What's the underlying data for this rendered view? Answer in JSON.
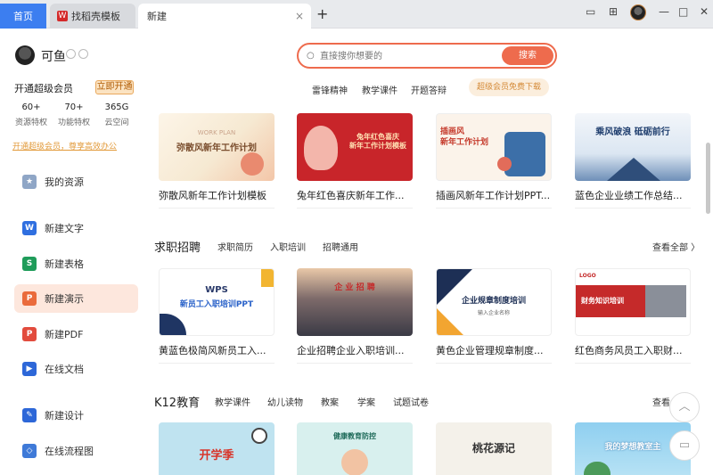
{
  "tabs": {
    "home": "首页",
    "template": "找稻壳模板",
    "new": "新建",
    "template_icon": "W",
    "close": "×",
    "plus": "+"
  },
  "window_buttons": {
    "layout": "▭",
    "grid": "⊞",
    "minimize": "—",
    "maximize": "□",
    "close": "✕"
  },
  "user": {
    "name": "可鱼"
  },
  "vip": {
    "title": "开通超级会员",
    "button": "立即开通",
    "stats": [
      {
        "value": "60+",
        "label": "资源特权"
      },
      {
        "value": "70+",
        "label": "功能特权"
      },
      {
        "value": "365G",
        "label": "云空间"
      }
    ],
    "link": "开通超级会员，尊享高效办公"
  },
  "nav": [
    {
      "label": "我的资源",
      "icon": "★"
    },
    {
      "label": "新建文字",
      "icon": "W"
    },
    {
      "label": "新建表格",
      "icon": "S"
    },
    {
      "label": "新建演示",
      "icon": "P"
    },
    {
      "label": "新建PDF",
      "icon": "P"
    },
    {
      "label": "在线文档",
      "icon": "▶"
    },
    {
      "label": "新建设计",
      "icon": "✎"
    },
    {
      "label": "在线流程图",
      "icon": "◇"
    }
  ],
  "search": {
    "placeholder": "直接搜你想要的",
    "button": "搜索",
    "icon": "○"
  },
  "hot": [
    "雷锋精神",
    "教学课件",
    "开题答辩"
  ],
  "vip_download": "超级会员免费下载",
  "row1": [
    {
      "title": "弥散风新年工作计划模板",
      "thumb": "弥散风新年工作计划",
      "small": "WORK PLAN"
    },
    {
      "title": "兔年红色喜庆新年工作...",
      "thumb": "兔年红色喜庆\n新年工作计划模板",
      "small": ""
    },
    {
      "title": "插画风新年工作计划PPT...",
      "thumb": "插画风\n新年工作计划",
      "small": ""
    },
    {
      "title": "蓝色企业业绩工作总结...",
      "thumb": "乘风破浪 砥砺前行",
      "small": ""
    }
  ],
  "sections": [
    {
      "title": "求职招聘",
      "subs": [
        "求职简历",
        "入职培训",
        "招聘通用"
      ],
      "see_all": "查看全部 〉"
    },
    {
      "title": "K12教育",
      "subs": [
        "教学课件",
        "幼儿读物",
        "教案",
        "学案",
        "试题试卷"
      ],
      "see_all": "查看"
    }
  ],
  "row2": [
    {
      "title": "黄蓝色极简风新员工入...",
      "thumb": "新员工入职培训PPT",
      "small": "WPS"
    },
    {
      "title": "企业招聘企业入职培训...",
      "thumb": "企 业 招 聘",
      "small": ""
    },
    {
      "title": "黄色企业管理规章制度...",
      "thumb": "企业规章制度培训",
      "small": "输入企业名称"
    },
    {
      "title": "红色商务风员工入职财...",
      "thumb": "财务知识培训",
      "small": "LOGO"
    }
  ],
  "row3": [
    {
      "thumb": "开学季"
    },
    {
      "thumb": "健康教育防控"
    },
    {
      "thumb": "桃花源记"
    },
    {
      "thumb": "我的梦想教室主"
    }
  ],
  "float": {
    "top": "︿",
    "chat": "▭"
  }
}
